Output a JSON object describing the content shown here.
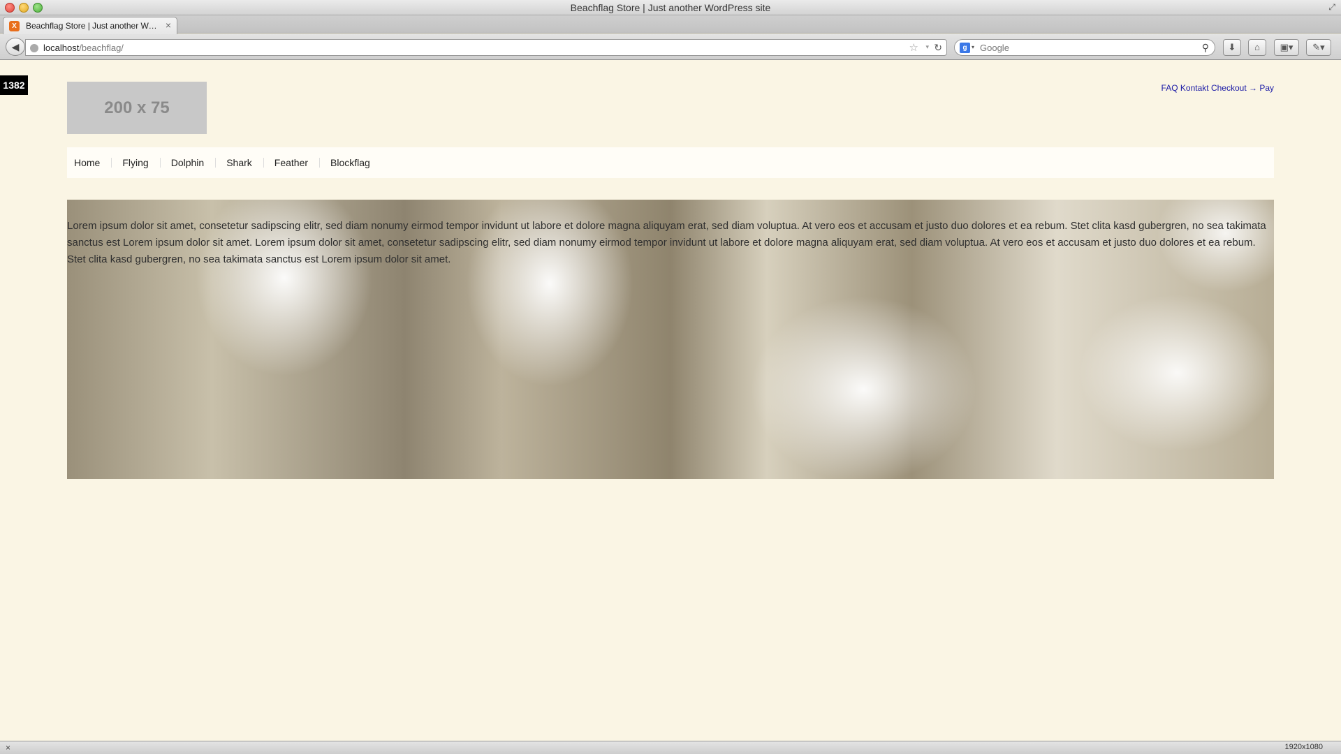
{
  "window": {
    "title": "Beachflag Store | Just another WordPress site"
  },
  "tab": {
    "title": "Beachflag Store | Just another WordPress site",
    "close": "×",
    "favicon_icon": "xampp-icon"
  },
  "toolbar": {
    "back": "◀",
    "url_host": "localhost",
    "url_path": "/beachflag/",
    "star": "☆",
    "dropdown": "▾",
    "reload": "↻",
    "search_engine": "g",
    "search_placeholder": "Google",
    "search_go": "⚲",
    "download": "⬇",
    "home": "⌂",
    "panel": "▣▾",
    "tools": "✎▾"
  },
  "page": {
    "counter": "1382",
    "logo_text": "200 x 75",
    "top_links": [
      "FAQ",
      "Kontakt",
      "Checkout → Pay"
    ],
    "nav": [
      "Home",
      "Flying",
      "Dolphin",
      "Shark",
      "Feather",
      "Blockflag"
    ],
    "hero_text": "Lorem ipsum dolor sit amet, consetetur sadipscing elitr, sed diam nonumy eirmod tempor invidunt ut labore et dolore magna aliquyam erat, sed diam voluptua. At vero eos et accusam et justo duo dolores et ea rebum. Stet clita kasd gubergren, no sea takimata sanctus est Lorem ipsum dolor sit amet. Lorem ipsum dolor sit amet, consetetur sadipscing elitr, sed diam nonumy eirmod tempor invidunt ut labore et dolore magna aliquyam erat, sed diam voluptua. At vero eos et accusam et justo duo dolores et ea rebum. Stet clita kasd gubergren, no sea takimata sanctus est Lorem ipsum dolor sit amet."
  },
  "statusbar": {
    "close": "×",
    "size": "1920x1080"
  }
}
